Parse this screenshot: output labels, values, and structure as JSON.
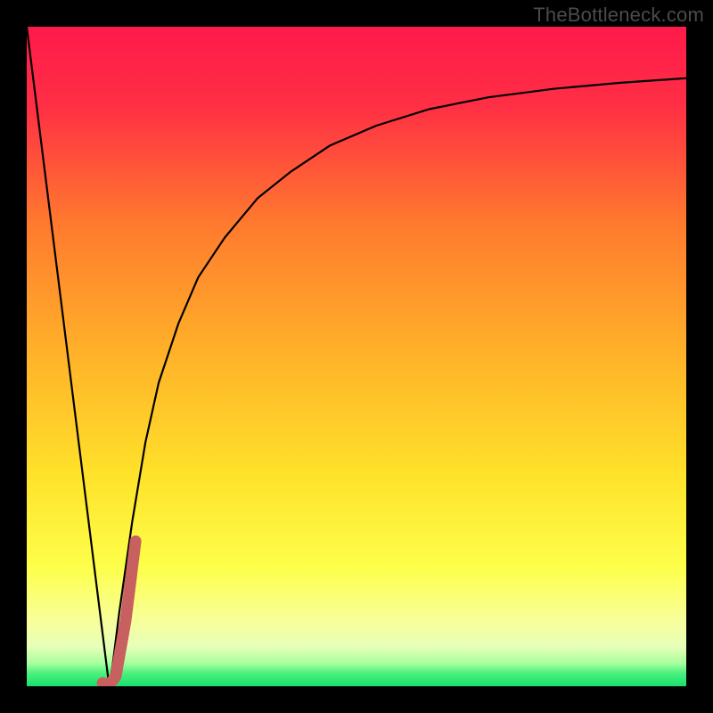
{
  "watermark": "TheBottleneck.com",
  "colors": {
    "bg": "#000000",
    "grad_top": "#ff1a4b",
    "grad_mid": "#ffd02b",
    "grad_low": "#fffb86",
    "grad_green": "#18e06b",
    "curve": "#000000",
    "marker": "#c7605e"
  },
  "chart_data": {
    "type": "line",
    "title": "",
    "xlabel": "",
    "ylabel": "",
    "xlim": [
      0,
      100
    ],
    "ylim": [
      0,
      100
    ],
    "series": [
      {
        "name": "bottleneck-curve",
        "x": [
          0,
          3,
          6,
          9,
          12,
          12.5,
          13,
          14,
          16,
          18,
          20,
          23,
          26,
          30,
          35,
          40,
          46,
          53,
          61,
          70,
          80,
          90,
          100
        ],
        "values": [
          100,
          76,
          52,
          28,
          4,
          0,
          3,
          11,
          25,
          37,
          46,
          55,
          62,
          68,
          74,
          78,
          82,
          85,
          87.5,
          89.3,
          90.6,
          91.5,
          92.2
        ]
      },
      {
        "name": "optimal-marker",
        "x": [
          11.5,
          12.5,
          13.5,
          15,
          16.5
        ],
        "values": [
          0.5,
          0.2,
          1.5,
          10,
          22
        ]
      }
    ],
    "annotations": []
  }
}
